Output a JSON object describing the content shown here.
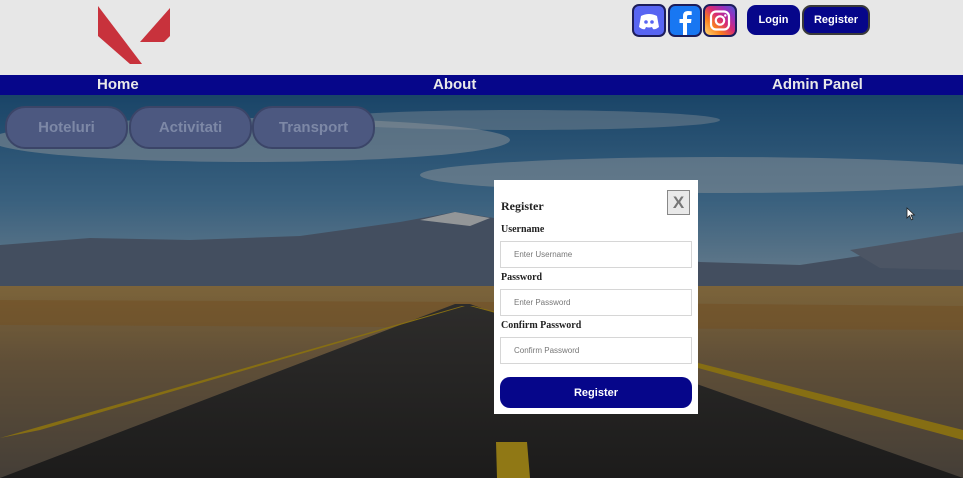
{
  "header": {
    "logo_icon": "red-v-logo",
    "social": [
      {
        "name": "discord",
        "icon": "discord-icon"
      },
      {
        "name": "facebook",
        "icon": "facebook-icon"
      },
      {
        "name": "instagram",
        "icon": "instagram-icon"
      }
    ],
    "login_label": "Login",
    "register_label": "Register"
  },
  "nav": {
    "home": "Home",
    "about": "About",
    "admin": "Admin Panel"
  },
  "categories": [
    "Hoteluri",
    "Activitati",
    "Transport"
  ],
  "modal": {
    "title": "Register",
    "close_label": "X",
    "username_label": "Username",
    "username_placeholder": "Enter Username",
    "password_label": "Password",
    "password_placeholder": "Enter Password",
    "confirm_label": "Confirm Password",
    "confirm_placeholder": "Confirm Password",
    "submit_label": "Register"
  },
  "colors": {
    "brand": "#06068a",
    "logo": "#c8323c"
  }
}
